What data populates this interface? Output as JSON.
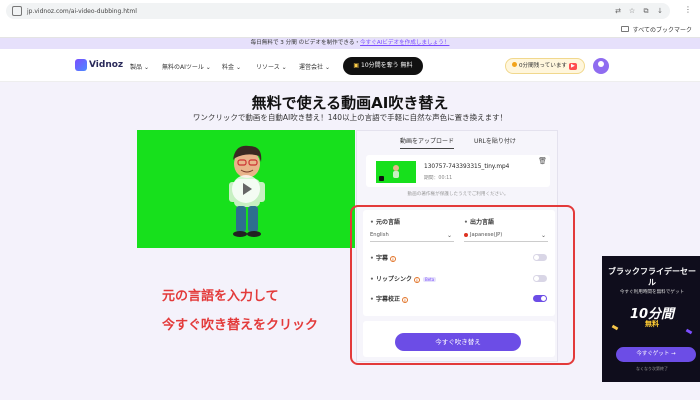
{
  "browser": {
    "url": "jp.vidnoz.com/ai-video-dubbing.html",
    "bookmark_label": "すべてのブックマーク"
  },
  "promo": {
    "text": "毎日無料で 3 分間 のビデオを制作できる・",
    "link": "今すぐAIビデオを作成しましょう！"
  },
  "nav": {
    "logo": "Vidnoz",
    "items": [
      "製品",
      "無料のAIツール",
      "料金",
      "リソース",
      "運営会社"
    ],
    "cta": "10分間を奪う 無料",
    "timer": "0分間残っています",
    "timer_badge": "▶"
  },
  "hero": {
    "title": "無料で使える動画AI吹き替え",
    "subtitle": "ワンクリックで動画を自動AI吹き替え！140以上の言語で手軽に自然な声色に置き換えます！"
  },
  "panel": {
    "tabs": [
      "動画をアップロード",
      "URLを貼り付け"
    ],
    "file_name": "130757-743393315_tiny.mp4",
    "file_duration": "期間：00:11",
    "notice": "動画の著作権が保護したうえでご利用ください。",
    "source_lang_label": "元の言語",
    "source_lang_value": "English",
    "target_lang_label": "出力言語",
    "target_lang_value": "Japanese(JP)",
    "subtitles_label": "字幕",
    "lipsync_label": "リップシンク",
    "beta": "Beta",
    "proofread_label": "字幕校正",
    "dub_button": "今すぐ吹き替え"
  },
  "annotations": {
    "line1": "元の言語を入力して",
    "line2": "今すぐ吹き替えをクリック"
  },
  "ad": {
    "title": "ブラックフライデーセール",
    "sub": "今すぐ利用時間を無料でゲット",
    "big": "10分間",
    "free": "無料",
    "button": "今すぐゲット →",
    "foot": "なくなり次第終了"
  },
  "colors": {
    "accent": "#6c4de6",
    "annotation": "#e33a3a",
    "video_bg": "#17e01c"
  }
}
